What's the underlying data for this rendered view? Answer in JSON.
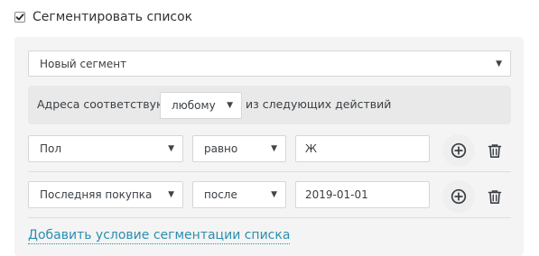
{
  "segment_checkbox": {
    "label": "Сегментировать список",
    "checked": true
  },
  "segment_select": {
    "value": "Новый сегмент"
  },
  "match": {
    "prefix": "Адреса соответствуют",
    "mode": "любому",
    "suffix": "из следующих действий"
  },
  "conditions": [
    {
      "field": "Пол",
      "operator": "равно",
      "value": "Ж"
    },
    {
      "field": "Последняя покупка",
      "operator": "после",
      "value": "2019-01-01"
    }
  ],
  "add_condition_link": "Добавить условие сегментации списка",
  "icons": {
    "add": "plus-circle-icon",
    "delete": "trash-icon",
    "caret": "caret-down-icon"
  }
}
